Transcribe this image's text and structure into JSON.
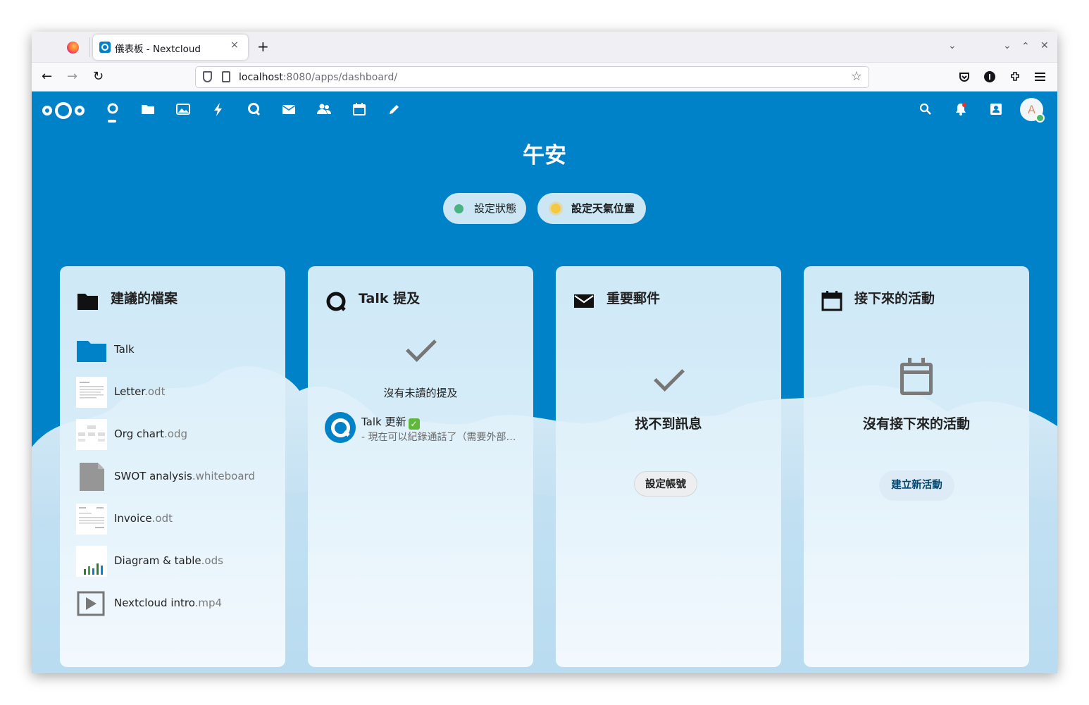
{
  "browser": {
    "tab_title": "儀表板 - Nextcloud",
    "tab_close": "×",
    "new_tab": "+",
    "url_host": "localhost",
    "url_path": ":8080/apps/dashboard/",
    "buttons": {
      "back": "←",
      "forward": "→",
      "reload": "↻"
    }
  },
  "header": {
    "apps": [
      "dashboard-icon",
      "files-icon",
      "photos-icon",
      "activity-icon",
      "talk-icon",
      "mail-icon",
      "contacts-icon",
      "calendar-icon",
      "notes-icon"
    ],
    "avatar_initial": "A"
  },
  "dashboard": {
    "greeting": "午安",
    "status_button": "設定狀態",
    "weather_button": "設定天氣位置"
  },
  "widgets": {
    "files": {
      "title": "建議的檔案",
      "items": [
        {
          "name": "Talk",
          "ext": ""
        },
        {
          "name": "Letter",
          "ext": ".odt"
        },
        {
          "name": "Org chart",
          "ext": ".odg"
        },
        {
          "name": "SWOT analysis",
          "ext": ".whiteboard"
        },
        {
          "name": "Invoice",
          "ext": ".odt"
        },
        {
          "name": "Diagram & table",
          "ext": ".ods"
        },
        {
          "name": "Nextcloud intro",
          "ext": ".mp4"
        }
      ]
    },
    "talk": {
      "title": "Talk 提及",
      "empty": "沒有未讀的提及",
      "item_title": "Talk 更新",
      "item_check": "✓",
      "item_subtitle": "- 現在可以紀錄通話了（需要外部錄製伺服器）"
    },
    "mail": {
      "title": "重要郵件",
      "empty": "找不到訊息",
      "button": "設定帳號"
    },
    "calendar": {
      "title": "接下來的活動",
      "empty": "沒有接下來的活動",
      "button": "建立新活動"
    }
  },
  "colors": {
    "brand": "#0082c9",
    "status_online": "#46ba61"
  }
}
